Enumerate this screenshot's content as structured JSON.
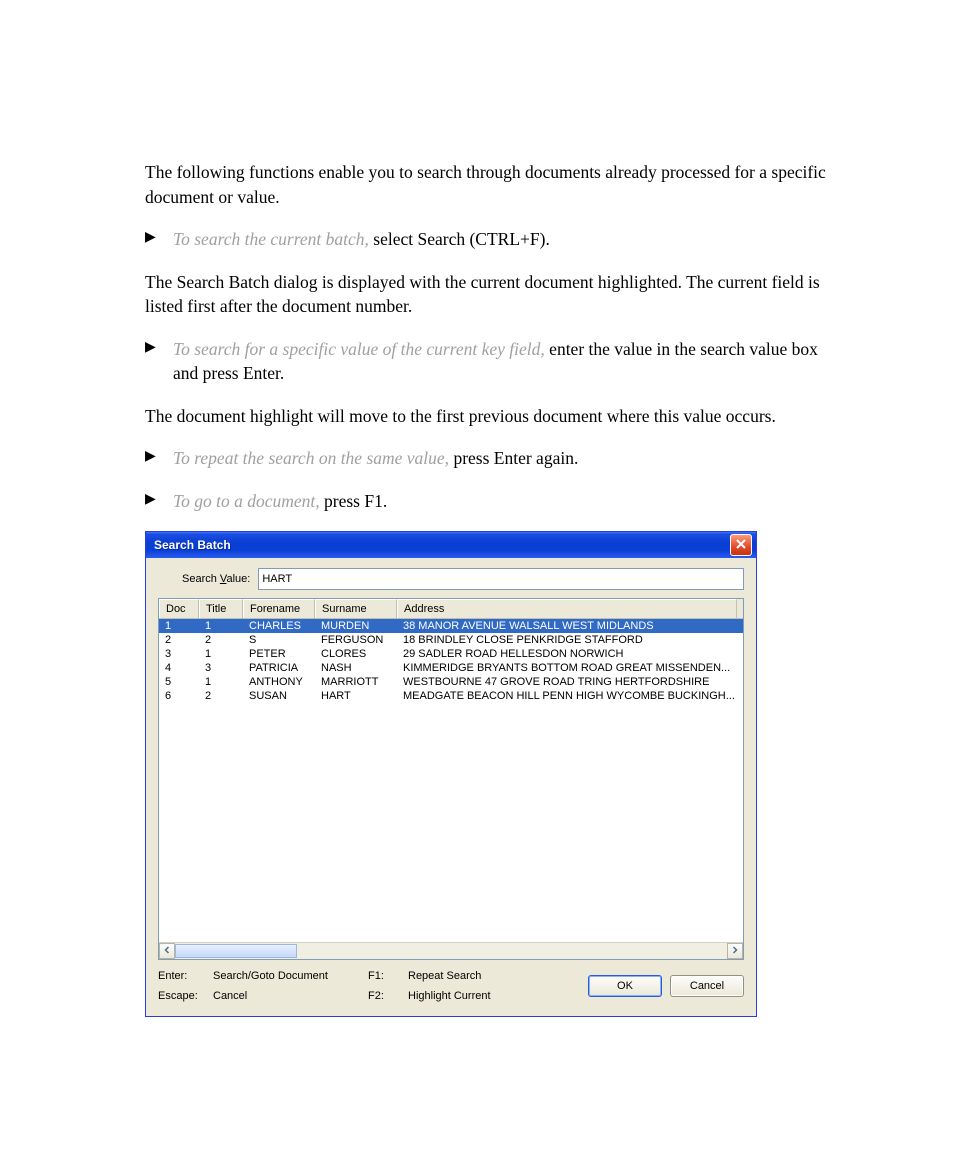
{
  "doc": {
    "intro": "The following functions enable you to search through documents already processed for a specific document or value.",
    "b1_lead": "To search the current batch, ",
    "b1_rest": "select Search (CTRL+F).",
    "p2": "The Search Batch dialog is displayed with the current document highlighted. The current field is listed first after the document number.",
    "b2_lead": "To search for a specific value of the current key field, ",
    "b2_rest": "enter the value in the search value box and press Enter.",
    "p3": "The document highlight will move to the first previous document where this value occurs.",
    "b3_lead": "To repeat the search on the same value, ",
    "b3_rest": "press Enter again.",
    "b4_lead": "To go to a document, ",
    "b4_rest": "press F1."
  },
  "dialog": {
    "title": "Search Batch",
    "search_label_pre": "Search ",
    "search_label_u": "V",
    "search_label_post": "alue:",
    "search_value": "HART",
    "columns": {
      "doc": "Doc",
      "title": "Title",
      "forename": "Forename",
      "surname": "Surname",
      "address": "Address"
    },
    "rows": [
      {
        "doc": "1",
        "title": "1",
        "forename": "CHARLES",
        "surname": "MURDEN",
        "address": "38 MANOR AVENUE WALSALL WEST MIDLANDS"
      },
      {
        "doc": "2",
        "title": "2",
        "forename": "S",
        "surname": "FERGUSON",
        "address": "18 BRINDLEY CLOSE PENKRIDGE STAFFORD"
      },
      {
        "doc": "3",
        "title": "1",
        "forename": "PETER",
        "surname": "CLORES",
        "address": "29 SADLER ROAD HELLESDON NORWICH"
      },
      {
        "doc": "4",
        "title": "3",
        "forename": "PATRICIA",
        "surname": "NASH",
        "address": "KIMMERIDGE BRYANTS BOTTOM ROAD GREAT MISSENDEN..."
      },
      {
        "doc": "5",
        "title": "1",
        "forename": "ANTHONY",
        "surname": "MARRIOTT",
        "address": "WESTBOURNE 47 GROVE ROAD TRING HERTFORDSHIRE"
      },
      {
        "doc": "6",
        "title": "2",
        "forename": "SUSAN",
        "surname": "HART",
        "address": "MEADGATE BEACON HILL PENN HIGH WYCOMBE BUCKINGH..."
      }
    ],
    "footer": {
      "enter_k": "Enter:",
      "enter_v": "Search/Goto Document",
      "f1_k": "F1:",
      "f1_v": "Repeat Search",
      "esc_k": "Escape:",
      "esc_v": "Cancel",
      "f2_k": "F2:",
      "f2_v": "Highlight Current",
      "ok": "OK",
      "cancel": "Cancel"
    }
  }
}
